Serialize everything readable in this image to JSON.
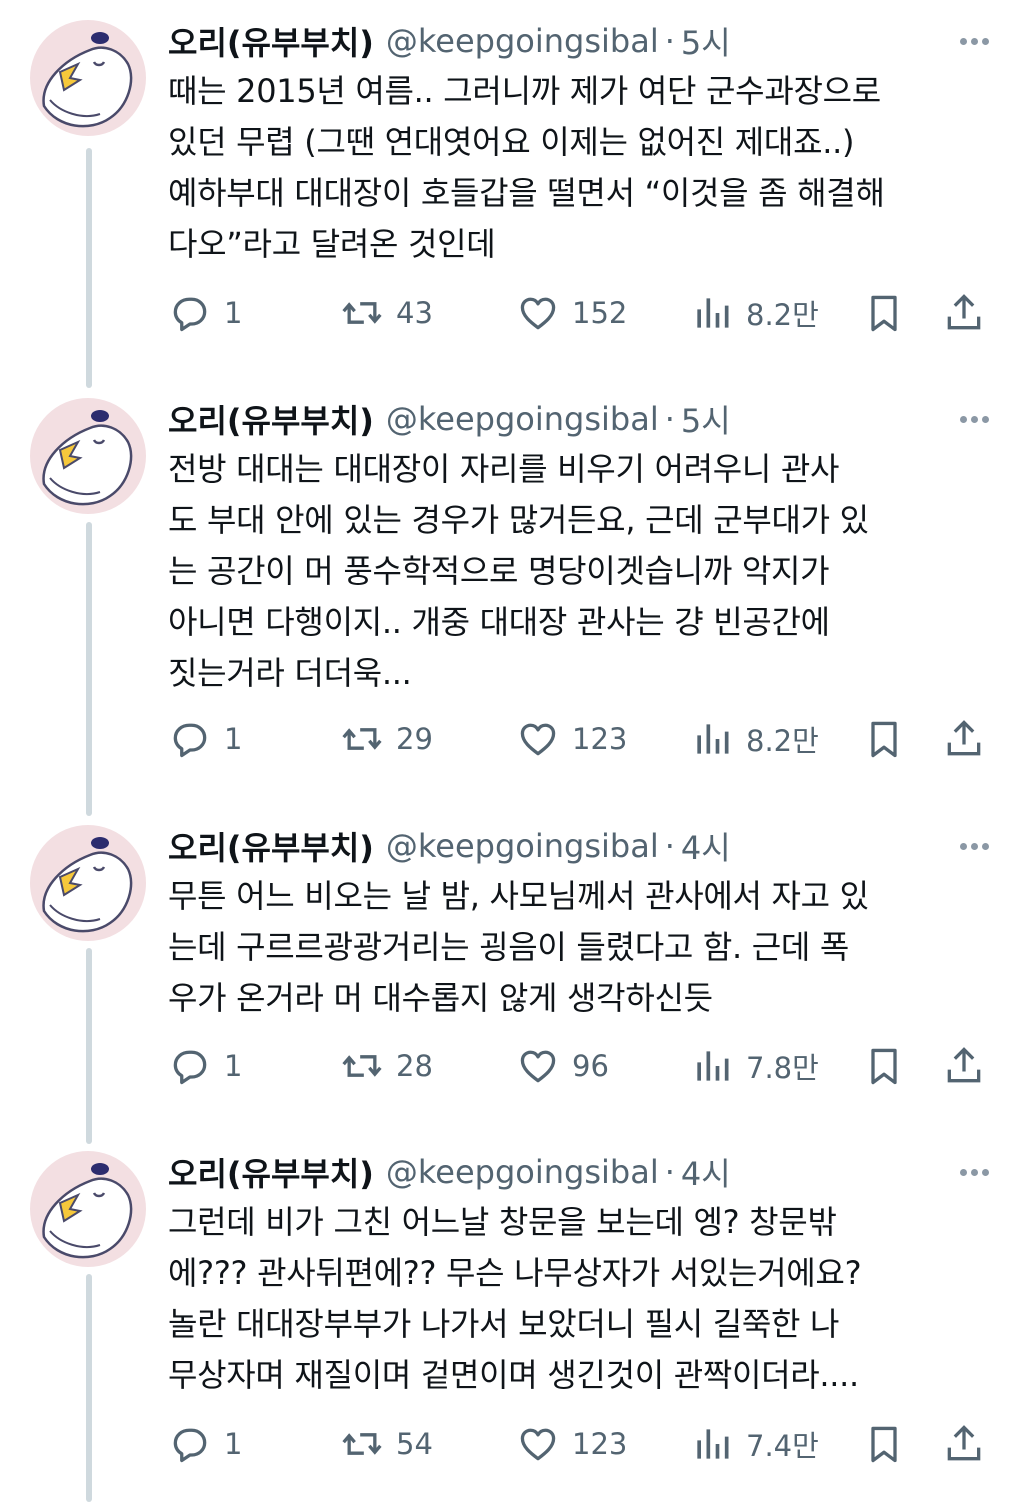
{
  "tweets": [
    {
      "name": "오리(유부부치)",
      "handle": "@keepgoingsibal",
      "time": "5시",
      "lines": [
        "때는 2015년 여름.. 그러니까 제가 여단 군수과장으로",
        "있던 무렵 (그땐 연대엿어요 이제는 없어진 제대죠..)",
        "예하부대 대대장이 호들갑을 떨면서 “이것을 좀 해결해",
        "다오”라고 달려온 것인데"
      ],
      "replies": "1",
      "retweets": "43",
      "likes": "152",
      "views": "8.2만"
    },
    {
      "name": "오리(유부부치)",
      "handle": "@keepgoingsibal",
      "time": "5시",
      "lines": [
        "전방 대대는 대대장이 자리를 비우기 어려우니 관사",
        "도 부대 안에 있는 경우가 많거든요, 근데 군부대가 있",
        "는 공간이 머 풍수학적으로 명당이겟습니까 악지가",
        "아니면 다행이지.. 개중 대대장 관사는 걍 빈공간에",
        "짓는거라 더더욱..."
      ],
      "replies": "1",
      "retweets": "29",
      "likes": "123",
      "views": "8.2만"
    },
    {
      "name": "오리(유부부치)",
      "handle": "@keepgoingsibal",
      "time": "4시",
      "lines": [
        "무튼 어느 비오는 날 밤, 사모님께서 관사에서 자고 있",
        "는데 구르르광광거리는 굉음이 들렸다고 함. 근데 폭",
        "우가 온거라 머 대수롭지 않게 생각하신듯"
      ],
      "replies": "1",
      "retweets": "28",
      "likes": "96",
      "views": "7.8만"
    },
    {
      "name": "오리(유부부치)",
      "handle": "@keepgoingsibal",
      "time": "4시",
      "lines": [
        "그런데 비가 그친 어느날 창문을 보는데 엥? 창문밖",
        "에??? 관사뒤편에?? 무슨 나무상자가 서있는거에요?",
        "놀란 대대장부부가 나가서 보았더니 필시 길쭉한 나",
        "무상자며 재질이며 겉면이며 생긴것이 관짝이더라...."
      ],
      "replies": "1",
      "retweets": "54",
      "likes": "123",
      "views": "7.4만"
    }
  ],
  "icons": {
    "reply": "speech-bubble-icon",
    "retweet": "retweet-arrows-icon",
    "like": "heart-icon",
    "views": "bar-chart-icon",
    "bookmark": "bookmark-icon",
    "share": "share-upload-icon",
    "more": "more-dots-icon",
    "avatar": "duck-avatar-icon"
  },
  "colors": {
    "text": "#0f1419",
    "secondary": "#536471",
    "thread_line": "#cfd9de",
    "avatar_bg": "#f3dfe2"
  }
}
